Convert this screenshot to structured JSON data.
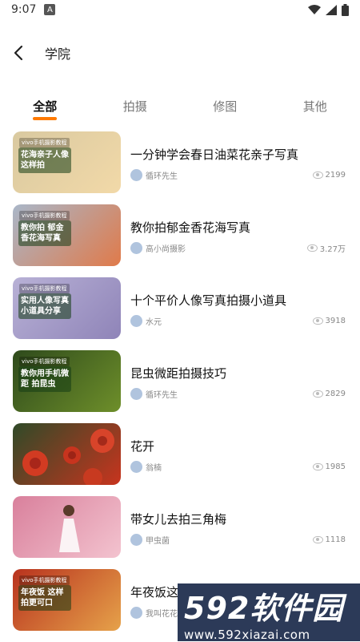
{
  "status": {
    "time": "9:07",
    "a_label": "A"
  },
  "header": {
    "title": "学院"
  },
  "tabs": [
    {
      "label": "全部"
    },
    {
      "label": "拍摄"
    },
    {
      "label": "修图"
    },
    {
      "label": "其他"
    }
  ],
  "items": [
    {
      "title": "一分钟学会春日油菜花亲子写真",
      "author": "循环先生",
      "views": "2199",
      "thumb_tag": "vivo手机摄影教程",
      "thumb_caption": "花海亲子人像 这样拍",
      "colors": [
        "#d9c9a0",
        "#f2d9a8"
      ]
    },
    {
      "title": "教你拍郁金香花海写真",
      "author": "高小尚摄影",
      "views": "3.27万",
      "thumb_tag": "vivo手机摄影教程",
      "thumb_caption": "教你拍 郁金香花海写真",
      "colors": [
        "#a9b7c9",
        "#e07a4a"
      ]
    },
    {
      "title": "十个平价人像写真拍摄小道具",
      "author": "水元",
      "views": "3918",
      "thumb_tag": "vivo手机摄影教程",
      "thumb_caption": "实用人像写真 小道具分享",
      "colors": [
        "#b8b1d6",
        "#8f84b8"
      ]
    },
    {
      "title": "昆虫微距拍摄技巧",
      "author": "循环先生",
      "views": "2829",
      "thumb_tag": "vivo手机摄影教程",
      "thumb_caption": "教你用手机微距 拍昆虫",
      "colors": [
        "#2e4a1c",
        "#6e8f2a"
      ]
    },
    {
      "title": "花开",
      "author": "翁楠",
      "views": "1985",
      "thumb_tag": "",
      "thumb_caption": "",
      "colors": [
        "#2f4a28",
        "#c8341e"
      ]
    },
    {
      "title": "带女儿去拍三角梅",
      "author": "甲虫菌",
      "views": "1118",
      "thumb_tag": "",
      "thumb_caption": "",
      "colors": [
        "#d9809c",
        "#f3c3cf"
      ]
    },
    {
      "title": "年夜饭这",
      "author": "我叫花花",
      "views": "",
      "thumb_tag": "vivo手机摄影教程",
      "thumb_caption": "年夜饭 这样拍更可口",
      "colors": [
        "#b8321e",
        "#e6a24a"
      ]
    }
  ],
  "watermark": {
    "line1": "592软件园",
    "line2": "www.592xiazai.com"
  }
}
